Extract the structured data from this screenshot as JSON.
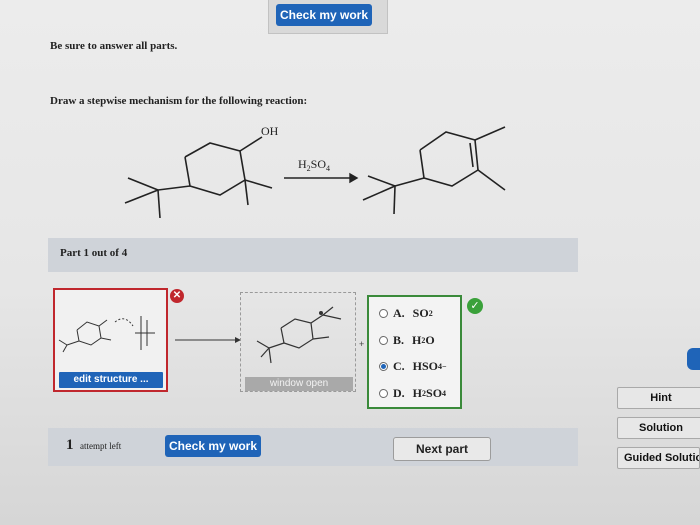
{
  "header": {
    "check_label": "Check my work"
  },
  "instructions": {
    "answer_all": "Be sure to answer all parts.",
    "prompt": "Draw a stepwise mechanism for the following reaction:"
  },
  "reaction": {
    "substituent_label": "OH",
    "reagent": "H",
    "reagent_sub1": "2",
    "reagent_mid": "SO",
    "reagent_sub2": "4"
  },
  "part": {
    "label": "Part 1 out of 4"
  },
  "editor": {
    "edit_label": "edit structure ...",
    "window_label": "window open"
  },
  "options": [
    {
      "letter": "A.",
      "formula": "SO",
      "sub": "2",
      "sup": "",
      "selected": false
    },
    {
      "letter": "B.",
      "formula": "H",
      "sub": "2",
      "tail": "O",
      "sup": "",
      "selected": false
    },
    {
      "letter": "C.",
      "formula": "HSO",
      "sub": "4",
      "sup": "−",
      "selected": true
    },
    {
      "letter": "D.",
      "formula": "H",
      "sub": "2",
      "tail": "SO",
      "sub2": "4",
      "sup": "",
      "selected": false
    }
  ],
  "footer": {
    "attempts_number": "1",
    "attempts_text": "attempt left",
    "check_label": "Check my work",
    "next_label": "Next part"
  },
  "sidebar": {
    "hint": "Hint",
    "solution": "Solution",
    "guided": "Guided Solutio"
  },
  "colors": {
    "accent": "#1f64b8",
    "error": "#c0272d",
    "correct": "#3aa13a"
  }
}
